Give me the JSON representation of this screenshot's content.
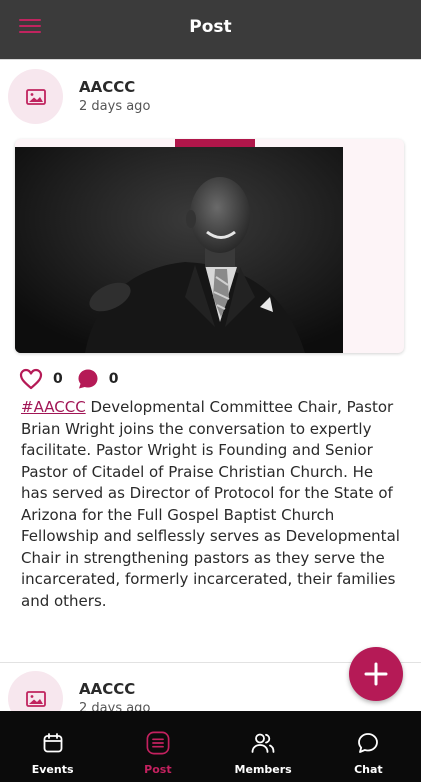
{
  "header": {
    "title": "Post"
  },
  "posts": [
    {
      "author": "AACCC",
      "time": "2 days ago",
      "likes": "0",
      "comments": "0",
      "hashtag": "#AACCC",
      "body": " Developmental Committee Chair, Pastor Brian Wright joins the conversation to expertly facilitate. Pastor Wright is Founding and Senior Pastor of Citadel of Praise Christian Church. He has served as Director of Protocol for the State of Arizona for the Full Gospel Baptist Church Fellowship and selflessly serves as Developmental Chair in strengthening pastors as they serve the incarcerated, formerly incarcerated, their families and others."
    },
    {
      "author": "AACCC",
      "time": "2 days ago"
    }
  ],
  "nav": [
    {
      "label": "Events",
      "icon": "calendar-icon"
    },
    {
      "label": "Post",
      "icon": "list-icon",
      "active": true
    },
    {
      "label": "Members",
      "icon": "users-icon"
    },
    {
      "label": "Chat",
      "icon": "chat-icon"
    }
  ],
  "colors": {
    "accent": "#b51a56",
    "topbar": "#3b3b3b",
    "nav_bg": "#0b0b0b",
    "avatar_bg": "#f7e7ee"
  }
}
